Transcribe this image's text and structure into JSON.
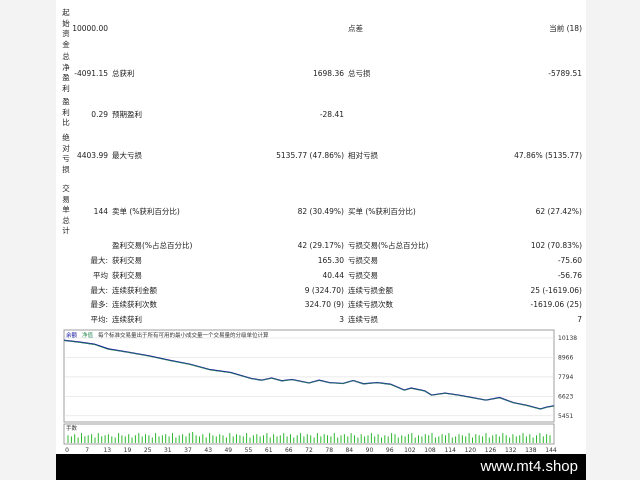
{
  "rows": {
    "initial_deposit": {
      "label": "起始资金",
      "value": "10000.00",
      "mid_label": "点差",
      "right_value": "当前 (18)"
    },
    "net_profit": {
      "label": "总净盈利",
      "value": "-4091.15",
      "gross_profit_label": "总获利",
      "gross_profit_value": "1698.36",
      "gross_loss_label": "总亏损",
      "gross_loss_value": "-5789.51"
    },
    "profit_factor": {
      "label": "盈利比",
      "value": "0.29",
      "expected_label": "预期盈利",
      "expected_value": "-28.41"
    },
    "abs_drawdown": {
      "label": "绝对亏损",
      "value": "4403.99",
      "max_dd_label": "最大亏损",
      "max_dd_value": "5135.77 (47.86%)",
      "rel_dd_label": "相对亏损",
      "rel_dd_value": "47.86% (5135.77)"
    },
    "total_trades": {
      "label": "交易单总计",
      "value": "144",
      "short_label": "卖单 (%获利百分比)",
      "short_value": "82 (30.49%)",
      "long_label": "买单 (%获利百分比)",
      "long_value": "62 (27.42%)"
    }
  },
  "stats": [
    {
      "prefix": "",
      "l_label": "盈利交易(%占总百分比)",
      "l_value": "42 (29.17%)",
      "r_label": "亏损交易(%占总百分比)",
      "r_value": "102 (70.83%)"
    },
    {
      "prefix": "最大:",
      "l_label": "获利交易",
      "l_value": "165.30",
      "r_label": "亏损交易",
      "r_value": "-75.60"
    },
    {
      "prefix": "平均",
      "l_label": "获利交易",
      "l_value": "40.44",
      "r_label": "亏损交易",
      "r_value": "-56.76"
    },
    {
      "prefix": "最大:",
      "l_label": "连续获利金额",
      "l_value": "9 (324.70)",
      "r_label": "连续亏损金额",
      "r_value": "25 (-1619.06)"
    },
    {
      "prefix": "最多:",
      "l_label": "连续获利次数",
      "l_value": "324.70 (9)",
      "r_label": "连续亏损次数",
      "r_value": "-1619.06 (25)"
    },
    {
      "prefix": "平均:",
      "l_label": "连续获利",
      "l_value": "3",
      "r_label": "连续亏损",
      "r_value": "7"
    }
  ],
  "chart_header": {
    "balance": "余额",
    "equity": "净值",
    "note": "每个标准交易量出于所有可用的最小成交量一个交易量的分级单位计算"
  },
  "volume_label": "手数",
  "chart_data": {
    "type": "line",
    "title": "",
    "xlabel": "",
    "ylabel": "",
    "x_ticks": [
      "0",
      "7",
      "13",
      "19",
      "25",
      "31",
      "37",
      "43",
      "49",
      "55",
      "61",
      "66",
      "72",
      "78",
      "84",
      "90",
      "96",
      "102",
      "108",
      "114",
      "120",
      "126",
      "132",
      "138",
      "144"
    ],
    "y_ticks": [
      "10138",
      "8966",
      "7794",
      "6623",
      "5451"
    ],
    "ylim": [
      5200,
      10500
    ],
    "xlim": [
      0,
      144
    ],
    "series": [
      {
        "name": "余额",
        "color": "#0a0aa0",
        "x": [
          0,
          5,
          9,
          13,
          19,
          25,
          31,
          37,
          43,
          49,
          55,
          58,
          61,
          64,
          67,
          72,
          75,
          78,
          82,
          85,
          88,
          92,
          96,
          100,
          102,
          106,
          108,
          112,
          116,
          120,
          124,
          128,
          132,
          136,
          140,
          142,
          144
        ],
        "y": [
          10000,
          9880,
          9760,
          9480,
          9280,
          9060,
          8800,
          8560,
          8230,
          8060,
          7700,
          7600,
          7730,
          7560,
          7640,
          7430,
          7600,
          7450,
          7400,
          7580,
          7380,
          7450,
          7350,
          7000,
          7120,
          6950,
          6700,
          6820,
          6700,
          6550,
          6400,
          6550,
          6250,
          6080,
          5860,
          5980,
          6050
        ]
      },
      {
        "name": "净值",
        "color": "#2e8b57",
        "x": [
          0,
          5,
          9,
          13,
          19,
          25,
          31,
          37,
          43,
          49,
          55,
          58,
          61,
          64,
          67,
          72,
          75,
          78,
          82,
          85,
          88,
          92,
          96,
          100,
          102,
          106,
          108,
          112,
          116,
          120,
          124,
          128,
          132,
          136,
          140,
          142,
          144
        ],
        "y": [
          10000,
          9860,
          9740,
          9450,
          9270,
          9040,
          8780,
          8540,
          8210,
          8040,
          7690,
          7590,
          7720,
          7550,
          7630,
          7420,
          7590,
          7440,
          7390,
          7570,
          7370,
          7440,
          7340,
          6990,
          7110,
          6940,
          6690,
          6810,
          6690,
          6540,
          6390,
          6540,
          6240,
          6070,
          5850,
          5970,
          6040
        ]
      }
    ],
    "volume": {
      "color": "#2eb82e",
      "values": [
        0.7,
        0.6,
        0.8,
        0.5,
        0.9,
        0.6,
        0.7,
        0.8,
        0.5,
        0.9,
        0.6,
        0.7,
        0.8,
        0.6,
        0.5,
        0.9,
        0.7,
        0.6,
        0.8,
        0.5,
        0.7,
        0.9,
        0.6,
        0.8,
        0.7,
        0.5,
        0.9,
        0.6,
        0.7,
        0.8,
        0.6,
        0.9,
        0.5,
        0.7,
        0.8,
        0.6,
        0.9,
        1.0,
        0.7,
        0.6,
        0.8,
        0.5,
        0.9,
        0.7,
        0.6,
        0.8,
        0.7,
        0.5,
        0.9,
        0.6,
        0.8,
        0.7,
        0.6,
        0.9,
        0.5,
        0.7,
        0.8,
        0.6,
        0.7,
        0.9,
        0.5,
        0.8,
        0.6,
        0.7,
        0.9,
        0.6,
        0.8,
        0.5,
        0.7,
        0.9,
        0.6,
        0.8,
        0.7,
        0.5,
        0.9,
        0.6,
        0.8,
        0.7,
        0.6,
        0.9,
        0.5,
        0.7,
        0.8,
        0.6,
        0.9,
        0.7,
        0.5,
        0.8,
        0.6,
        0.7,
        0.9,
        0.6,
        0.8,
        0.5,
        0.7,
        0.6,
        0.9,
        0.8,
        0.5,
        0.7,
        0.6,
        0.8,
        0.9,
        0.5,
        0.7,
        0.6,
        0.8,
        0.7,
        0.9,
        0.5,
        0.6,
        0.8,
        0.7,
        0.9,
        0.5,
        0.6,
        0.8,
        0.7,
        0.6,
        0.9,
        0.5,
        0.8,
        0.7,
        0.6,
        0.9,
        0.5,
        0.7,
        0.8,
        0.6,
        0.9,
        0.7,
        0.5,
        0.8,
        0.6,
        0.7,
        0.9,
        0.6,
        0.8,
        0.5,
        0.7,
        0.9,
        0.6,
        0.8,
        0.7
      ]
    }
  },
  "watermark": "www.mt4.shop"
}
